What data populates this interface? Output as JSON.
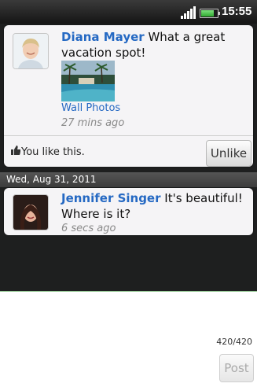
{
  "status_bar": {
    "time": "15:55",
    "battery_level": 0.8
  },
  "feed": {
    "post1": {
      "author": "Diana Mayer",
      "message": " What a great vacation spot!",
      "album_link": "Wall Photos",
      "time_ago": "27 mins ago",
      "like_text": "You like this.",
      "unlike_label": "Unlike"
    },
    "date_header": "Wed, Aug 31, 2011",
    "post2": {
      "author": "Jennifer Singer",
      "message": " It's beautiful! Where is it?",
      "time_ago": "6 secs ago"
    }
  },
  "composer": {
    "char_counter": "420/420",
    "post_label": "Post"
  },
  "colors": {
    "link_blue": "#2569c3",
    "card_bg": "#f5f4f6",
    "feed_bg": "#1e1f1f"
  }
}
